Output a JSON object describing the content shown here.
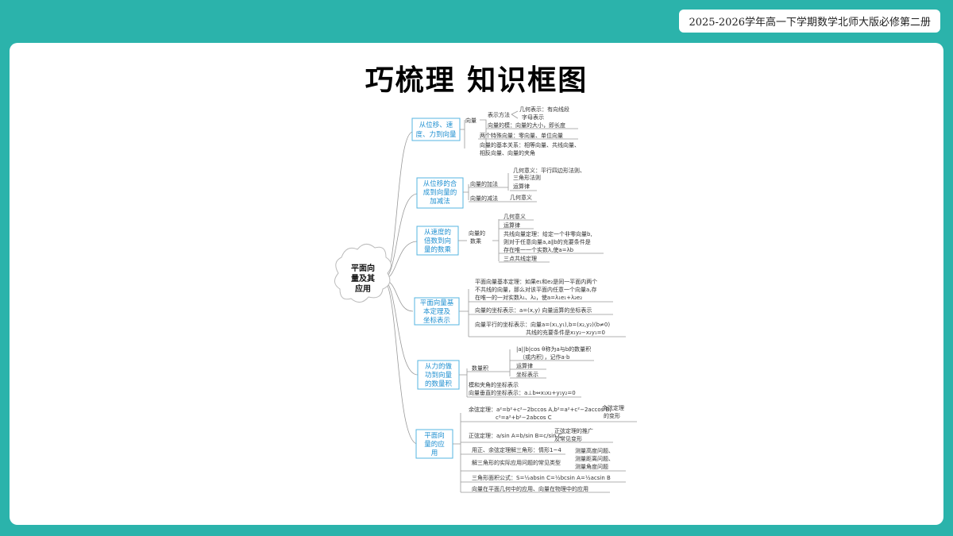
{
  "header": {
    "badge": "2025-2026学年高一下学期数学北师大版必修第二册"
  },
  "slide": {
    "title": "巧梳理  知识框图"
  },
  "mindmap": {
    "root": [
      "平面向",
      "量及其",
      "应用"
    ],
    "b1": {
      "label": [
        "从位移、速",
        "度、力到向量"
      ],
      "vec": "向量",
      "repr": "表示方法",
      "geo": "几何表示：有向线段",
      "letter": "字母表示",
      "mod": "向量的模：向量的大小，即长度",
      "special": "两个特殊向量：零向量、单位向量",
      "rel1": "向量的基本关系：相等向量、共线向量、",
      "rel2": "相反向量、向量的夹角"
    },
    "b2": {
      "label": [
        "从位移的合",
        "成到向量的",
        "加减法"
      ],
      "add": "向量的加法",
      "geo1": "几何意义：平行四边形法则、",
      "geo2": "三角形法则",
      "law": "运算律",
      "sub": "向量的减法",
      "subgeo": "几何意义"
    },
    "b3": {
      "label": [
        "从速度的",
        "倍数到向",
        "量的数乘"
      ],
      "op1": "向量的",
      "op2": "数乘",
      "geo": "几何意义",
      "law": "运算律",
      "thm1": "共线向量定理：给定一个非零向量b,",
      "thm2": "则对于任意向量a,a∥b的充要条件是",
      "thm3": "存在唯一一个实数λ,使a=λb",
      "three": "三点共线定理"
    },
    "b4": {
      "label": [
        "平面向量基",
        "本定理及",
        "坐标表示"
      ],
      "basic1": "平面向量基本定理：如果e₁和e₂是同一平面内两个",
      "basic2": "不共线的向量，那么对该平面内任意一个向量a,存",
      "basic3": "在唯一的一对实数λ₁、λ₂，使a=λ₁e₁+λ₂e₂",
      "coord": "向量的坐标表示：a=(x,y)   向量运算的坐标表示",
      "par1": "向量平行的坐标表示：向量a=(x₁,y₁),b=(x₂,y₂)(b≠0)",
      "par2": "共线的充要条件是x₁y₂−x₂y₁=0"
    },
    "b5": {
      "label": [
        "从力的做",
        "功到向量",
        "的数量积"
      ],
      "dot": "数量积",
      "def1": "|a||b|cos θ称为a与b的数量积",
      "def2": "（或内积），记作a·b",
      "law": "运算律",
      "coord": "坐标表示",
      "mod": "模和夹角的坐标表示",
      "perp": "向量垂直的坐标表示：a⊥b⇔x₁x₂+y₁y₂=0"
    },
    "b6": {
      "label": [
        "平面向",
        "量的应",
        "用"
      ],
      "cos1": "余弦定理：a²=b²+c²−2bccos A,b²=a²+c²−2accos B,",
      "cos2": "c²=a²+b²−2abcos C",
      "cosvar1": "余弦定理",
      "cosvar2": "的变形",
      "sin": "正弦定理：a/sin A=b/sin B=c/sin C",
      "sinext1": "正弦定理的推广",
      "sinext2": "及常见变形",
      "solve": "用正、余弦定理解三角形：情形1~4",
      "real": "解三角形的实际应用问题的常见类型",
      "h1": "测量高度问题、",
      "h2": "测量距离问题、",
      "h3": "测量角度问题",
      "area": "三角形面积公式：S=½absin C=½bcsin A=½acsin B",
      "app": "向量在平面几何中的应用、向量在物理中的应用"
    }
  }
}
